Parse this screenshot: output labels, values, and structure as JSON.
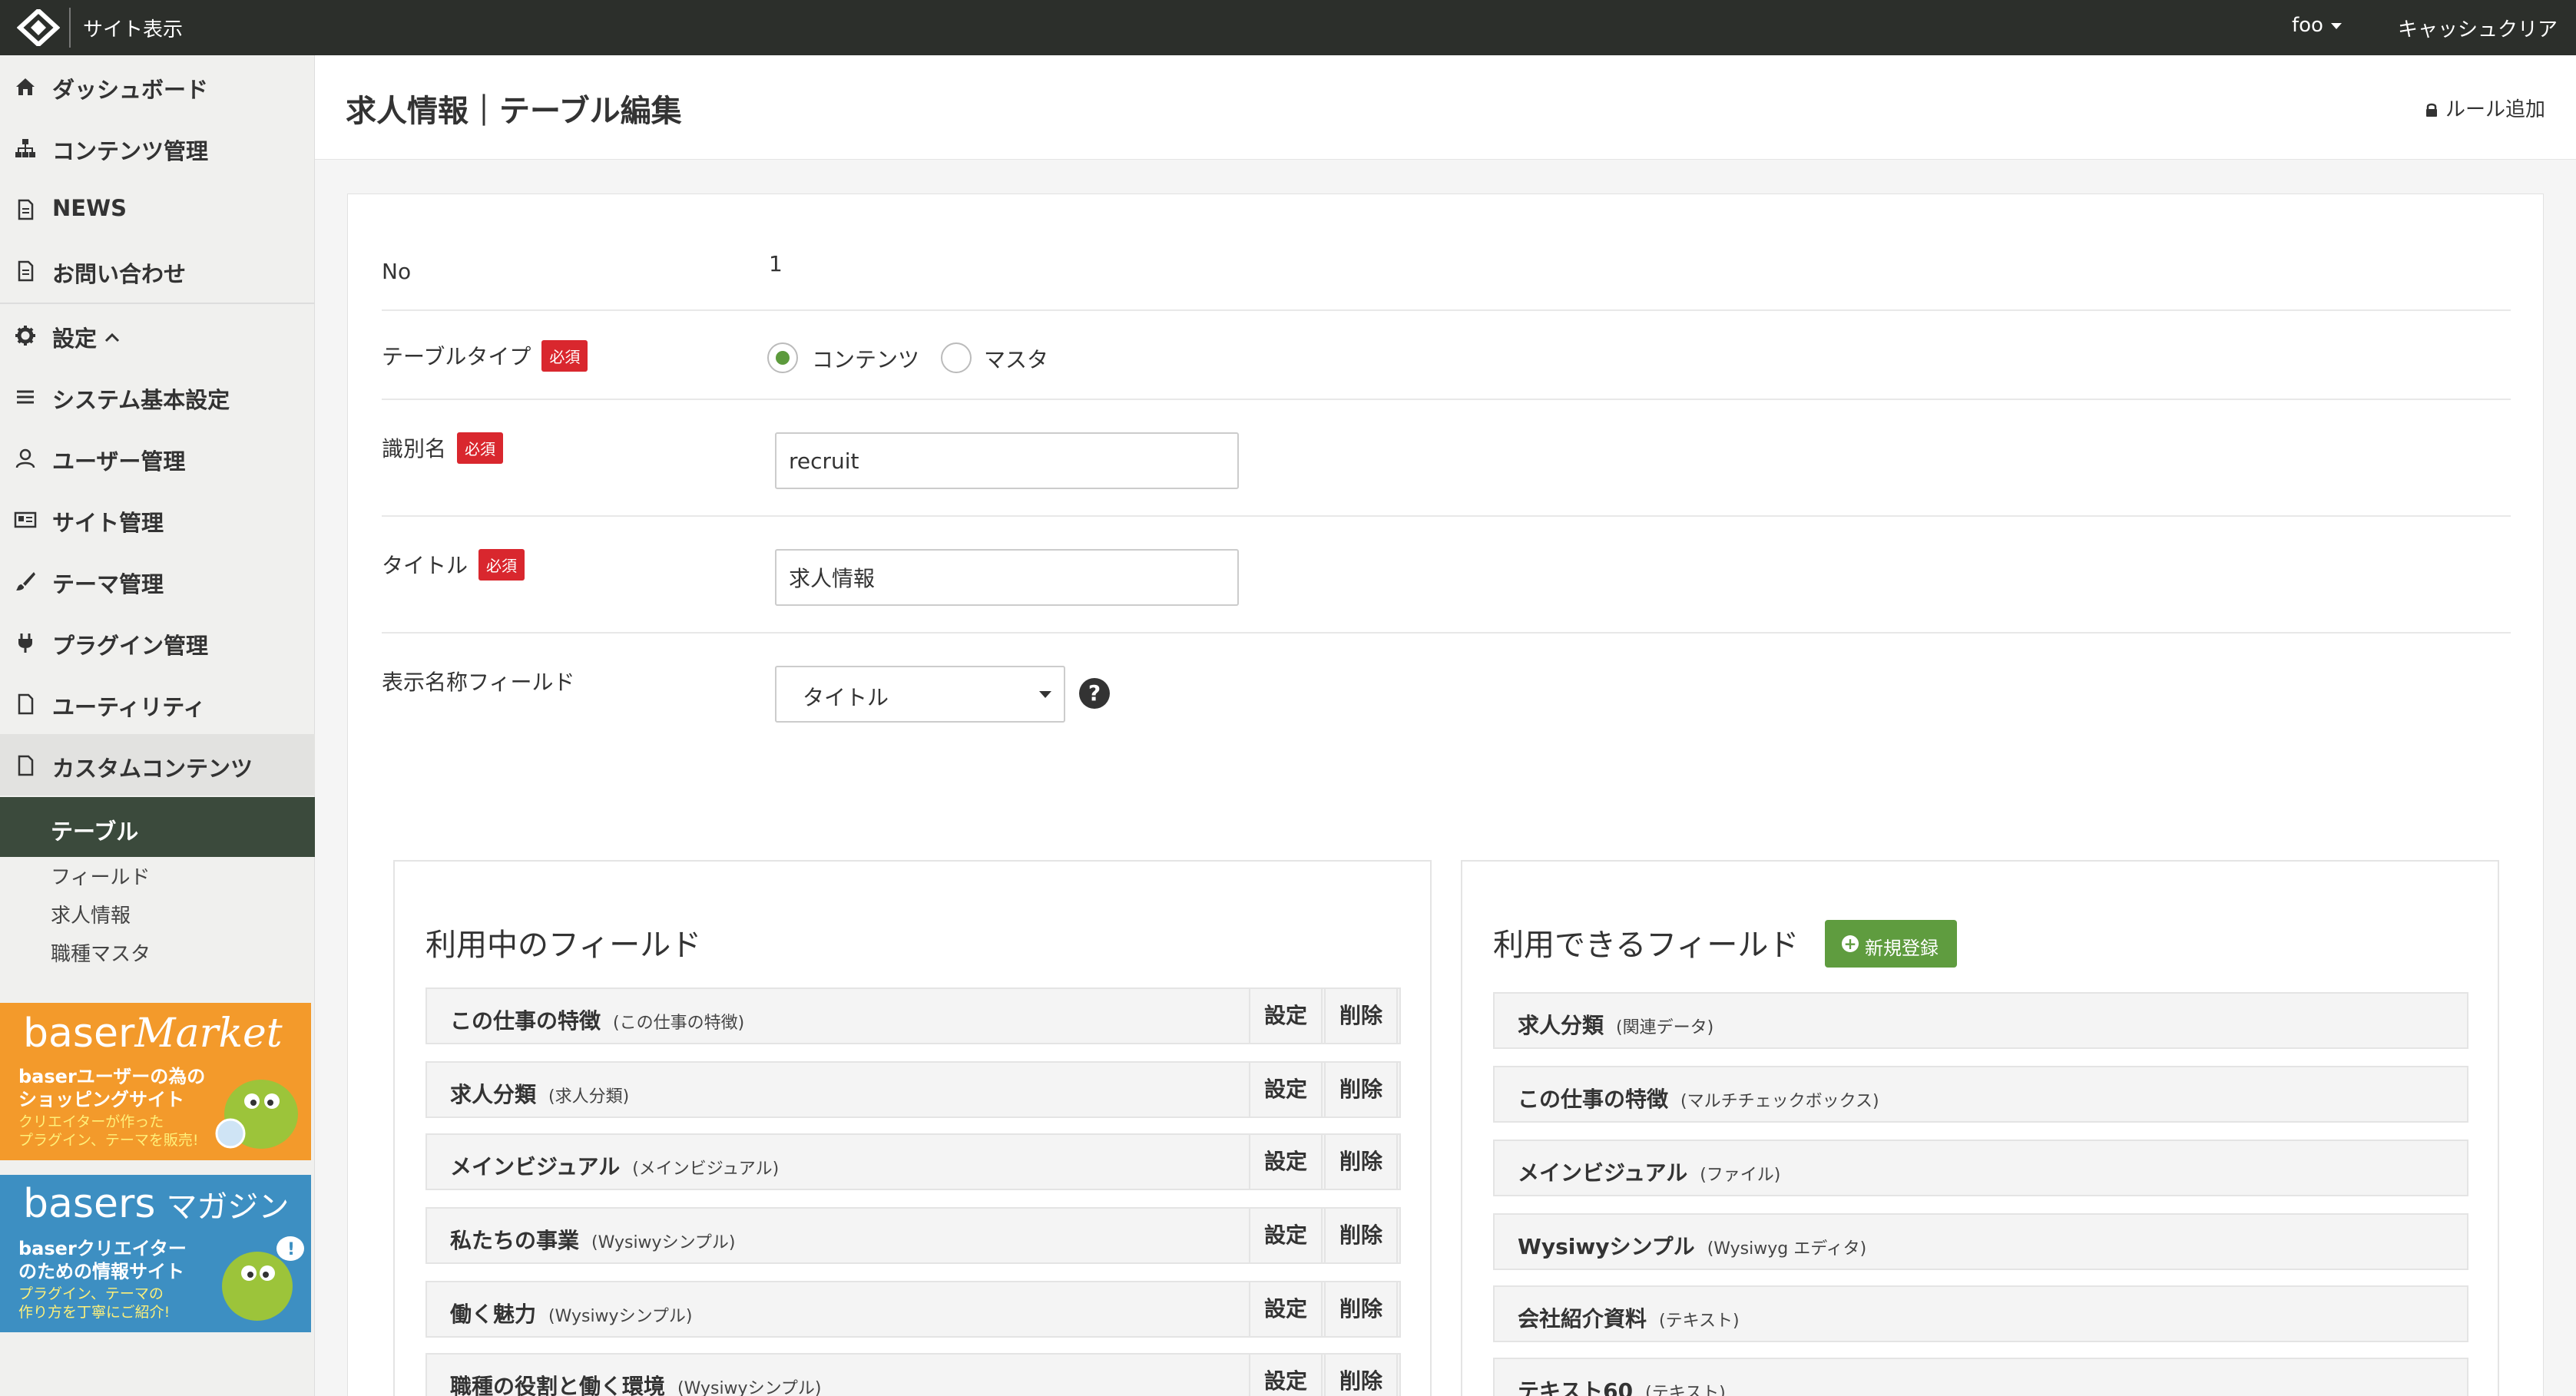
{
  "topbar": {
    "site_link": "サイト表示",
    "user": "foo",
    "cache_clear": "キャッシュクリア"
  },
  "sidebar": {
    "items": [
      {
        "label": "ダッシュボード",
        "icon": "home-icon"
      },
      {
        "label": "コンテンツ管理",
        "icon": "sitemap-icon"
      },
      {
        "label": "NEWS",
        "icon": "document-icon"
      },
      {
        "label": "お問い合わせ",
        "icon": "document-icon"
      },
      {
        "label": "設定",
        "icon": "gear-icon"
      },
      {
        "label": "システム基本設定",
        "icon": "menu-icon"
      },
      {
        "label": "ユーザー管理",
        "icon": "user-icon"
      },
      {
        "label": "サイト管理",
        "icon": "id-card-icon"
      },
      {
        "label": "テーマ管理",
        "icon": "brush-icon"
      },
      {
        "label": "プラグイン管理",
        "icon": "plug-icon"
      },
      {
        "label": "ユーティリティ",
        "icon": "document-icon"
      },
      {
        "label": "カスタムコンテンツ",
        "icon": "document-icon"
      }
    ],
    "sub_head": "テーブル",
    "sub_items": [
      "フィールド",
      "求人情報",
      "職種マスタ"
    ],
    "banners": {
      "market": {
        "brand": "baser",
        "brand2": "Market",
        "line1": "baserユーザーの為の",
        "line2": "ショッピングサイト",
        "line3": "クリエイターが作った",
        "line4": "プラグイン、テーマを販売!"
      },
      "magazine": {
        "brand": "basers",
        "brand2": "マガジン",
        "line1": "baserクリエイター",
        "line2": "のための情報サイト",
        "line3": "プラグイン、テーマの",
        "line4": "作り方を丁寧にご紹介!"
      }
    }
  },
  "header": {
    "title": "求人情報｜テーブル編集",
    "rule_add": "ルール追加"
  },
  "form": {
    "required": "必須",
    "no_label": "No",
    "no_value": "1",
    "table_type_label": "テーブルタイプ",
    "table_type_options": [
      "コンテンツ",
      "マスタ"
    ],
    "table_type_selected": "コンテンツ",
    "identifier_label": "識別名",
    "identifier_value": "recruit",
    "title_label": "タイトル",
    "title_value": "求人情報",
    "display_field_label": "表示名称フィールド",
    "display_field_value": "タイトル",
    "help": "?"
  },
  "used_fields": {
    "title": "利用中のフィールド",
    "settings_label": "設定",
    "delete_label": "削除",
    "rows": [
      {
        "name": "この仕事の特徴",
        "type": "(この仕事の特徴)"
      },
      {
        "name": "求人分類",
        "type": "(求人分類)"
      },
      {
        "name": "メインビジュアル",
        "type": "(メインビジュアル)"
      },
      {
        "name": "私たちの事業",
        "type": "(Wysiwyシンプル)"
      },
      {
        "name": "働く魅力",
        "type": "(Wysiwyシンプル)"
      },
      {
        "name": "職種の役割と働く環境",
        "type": "(Wysiwyシンプル)"
      }
    ]
  },
  "available_fields": {
    "title": "利用できるフィールド",
    "new_label": "新規登録",
    "rows": [
      {
        "name": "求人分類",
        "type": "(関連データ)"
      },
      {
        "name": "この仕事の特徴",
        "type": "(マルチチェックボックス)"
      },
      {
        "name": "メインビジュアル",
        "type": "(ファイル)"
      },
      {
        "name": "Wysiwyシンプル",
        "type": "(Wysiwyg エディタ)"
      },
      {
        "name": "会社紹介資料",
        "type": "(テキスト)"
      },
      {
        "name": "テキスト60",
        "type": "(テキスト)"
      }
    ]
  },
  "colors": {
    "topbar": "#2c2f2b",
    "accent_green": "#5f9c3f",
    "required_red": "#d9272e",
    "sidebar_active": "#3b4a3c",
    "market_orange": "#f39a2b",
    "magazine_blue": "#3d8fc2"
  }
}
